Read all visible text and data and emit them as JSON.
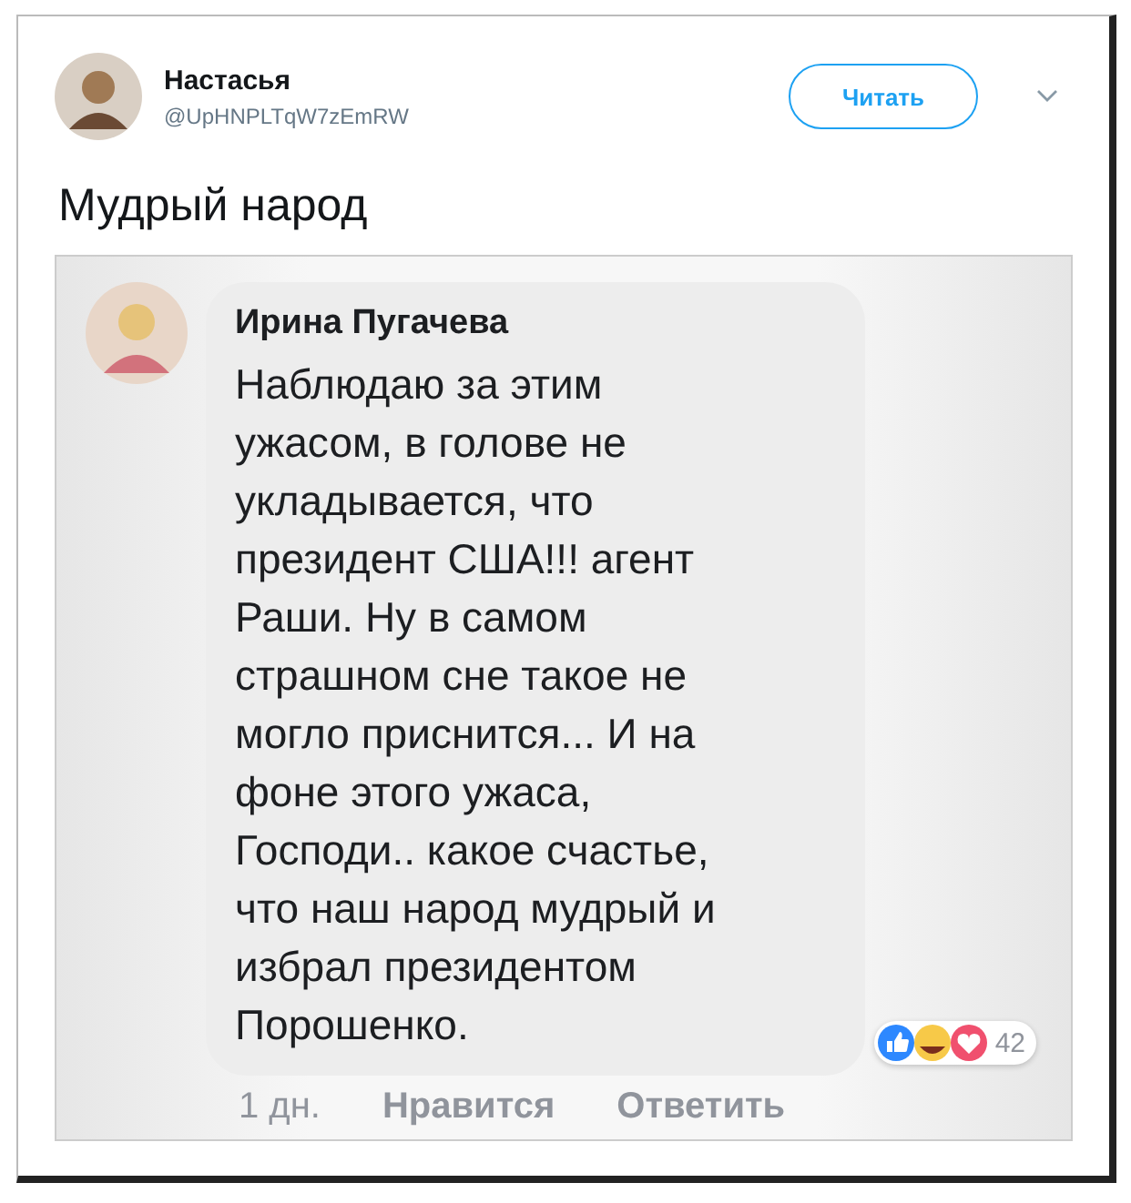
{
  "tweet": {
    "author": {
      "name": "Настасья",
      "handle": "@UpHNPLTqW7zEmRW"
    },
    "follow_button": "Читать",
    "text": "Мудрый народ",
    "image": {
      "comment": {
        "author": "Ирина Пугачева",
        "text": "Наблюдаю за этим\nужасом, в голове не\nукладывается, что\nпрезидент США!!! агент\nРаши. Ну в самом\nстрашном сне такое не\nмогло приснится...  И на\nфоне этого ужаса,\nГосподи..  какое счастье,\nчто наш народ мудрый и\nизбрал президентом\nПорошенко.",
        "reactions_count": "42",
        "time": "1 дн.",
        "actions": [
          "Нравится",
          "Ответить"
        ]
      }
    }
  }
}
